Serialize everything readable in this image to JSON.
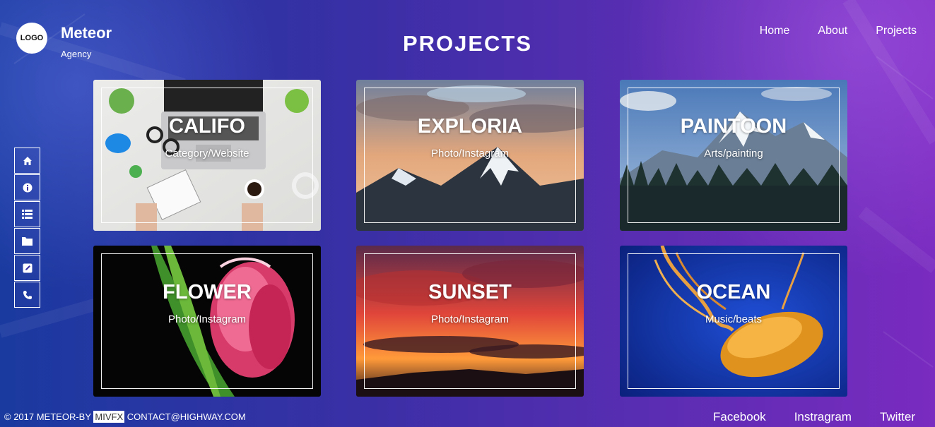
{
  "brand": {
    "logo_text": "LOGO",
    "name": "Meteor",
    "sub": "Agency"
  },
  "page_title": "PROJECTS",
  "nav": [
    "Home",
    "About",
    "Projects"
  ],
  "sidebar": [
    "home-icon",
    "info-icon",
    "list-icon",
    "folder-icon",
    "edit-icon",
    "phone-icon"
  ],
  "projects": [
    {
      "title": "CALIFO",
      "category": "Category/Website"
    },
    {
      "title": "EXPLORIA",
      "category": "Photo/Instagram"
    },
    {
      "title": "PAINTOON",
      "category": "Arts/painting"
    },
    {
      "title": "FLOWER",
      "category": "Photo/Instagram"
    },
    {
      "title": "SUNSET",
      "category": "Photo/Instagram"
    },
    {
      "title": "OCEAN",
      "category": "Music/beats"
    }
  ],
  "footer": {
    "copyright_pre": "© 2017 METEOR-BY ",
    "copyright_highlight": "MIVFX",
    "copyright_post": " CONTACT@HIGHWAY.COM",
    "social": [
      "Facebook",
      "Instragram",
      "Twitter"
    ]
  }
}
